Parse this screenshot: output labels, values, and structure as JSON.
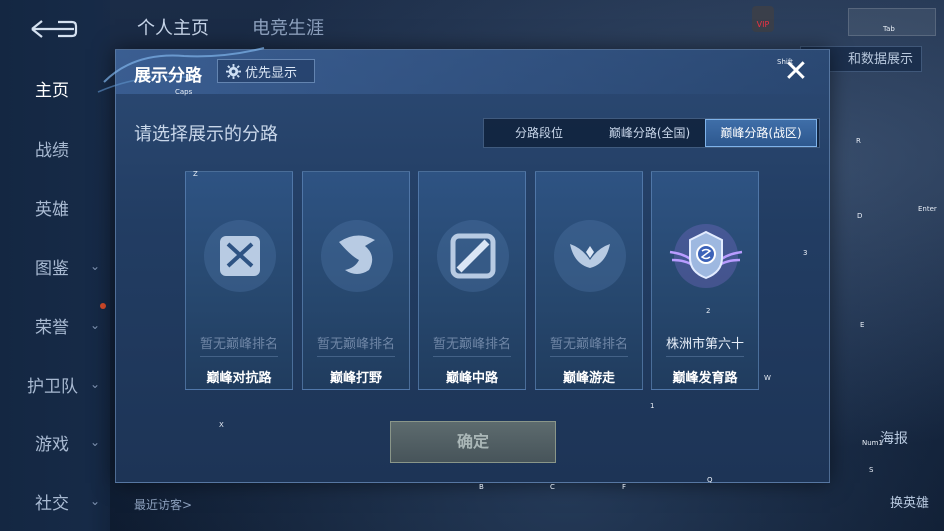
{
  "background": {
    "top_tabs": [
      "个人主页",
      "电竞生涯"
    ],
    "vip_badge": "VIP",
    "data_button": "和数据展示",
    "recent_visitors": "最近访客>",
    "right_labels": [
      "海报",
      "换英雄"
    ]
  },
  "sidebar": {
    "items": [
      {
        "label": "主页",
        "chevron": false,
        "active": true
      },
      {
        "label": "战绩",
        "chevron": false
      },
      {
        "label": "英雄",
        "chevron": false
      },
      {
        "label": "图鉴",
        "chevron": true
      },
      {
        "label": "荣誉",
        "chevron": true
      },
      {
        "label": "护卫队",
        "chevron": true
      },
      {
        "label": "游戏",
        "chevron": true
      },
      {
        "label": "社交",
        "chevron": true
      }
    ]
  },
  "modal": {
    "title": "展示分路",
    "priority_button": "优先显示",
    "subtitle": "请选择展示的分路",
    "tabs": [
      {
        "label": "分路段位",
        "active": false
      },
      {
        "label": "巅峰分路(全国)",
        "active": false
      },
      {
        "label": "巅峰分路(战区)",
        "active": true
      }
    ],
    "cards": [
      {
        "rank": "暂无巅峰排名",
        "lane": "巅峰对抗路",
        "icon": "sword-shield-icon",
        "ranked": false
      },
      {
        "rank": "暂无巅峰排名",
        "lane": "巅峰打野",
        "icon": "dragon-icon",
        "ranked": false
      },
      {
        "rank": "暂无巅峰排名",
        "lane": "巅峰中路",
        "icon": "staff-icon",
        "ranked": false
      },
      {
        "rank": "暂无巅峰排名",
        "lane": "巅峰游走",
        "icon": "wings-icon",
        "ranked": false
      },
      {
        "rank": "株洲市第六十",
        "lane": "巅峰发育路",
        "icon": "winged-crest-icon",
        "ranked": true
      }
    ],
    "confirm_button": "确定"
  },
  "key_hints": [
    "Caps",
    "Z",
    "X",
    "2",
    "3",
    "W",
    "1",
    "B",
    "C",
    "F",
    "Q",
    "Shift",
    "R",
    "D",
    "E",
    "S",
    "Tab",
    "Enter",
    "Num1"
  ],
  "colors": {
    "active_tab": "#3f6ea8",
    "confirm_bg": "#5d6b6e",
    "modal_bg": "#223d63"
  }
}
